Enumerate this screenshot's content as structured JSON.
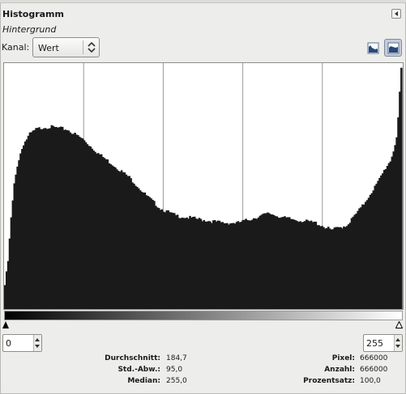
{
  "panel": {
    "title": "Histogramm",
    "layer_name": "Hintergrund"
  },
  "channel": {
    "label": "Kanal:",
    "selected": "Wert"
  },
  "mode_buttons": [
    {
      "name": "linear-histogram",
      "active": false
    },
    {
      "name": "logarithmic-histogram",
      "active": true
    }
  ],
  "range": {
    "low": "0",
    "high": "255"
  },
  "stats": {
    "mean_label": "Durchschnitt:",
    "mean_value": "184,7",
    "std_label": "Std.-Abw.:",
    "std_value": "95,0",
    "median_label": "Median:",
    "median_value": "255,0",
    "pixels_label": "Pixel:",
    "pixels_value": "666000",
    "count_label": "Anzahl:",
    "count_value": "666000",
    "percentile_label": "Prozentsatz:",
    "percentile_value": "100,0"
  },
  "colors": {
    "bars": "#1a1a1a",
    "background": "#ededeb",
    "graph_bg": "#ffffff"
  },
  "chart_data": {
    "type": "area",
    "x_range": [
      0,
      255
    ],
    "y_range": [
      0,
      1
    ],
    "grid": true,
    "title": "",
    "xlabel": "",
    "ylabel": "",
    "x": [
      0,
      2,
      4,
      6,
      8,
      10,
      12,
      16,
      20,
      25,
      30,
      40,
      50,
      60,
      70,
      80,
      90,
      100,
      110,
      120,
      130,
      140,
      150,
      160,
      170,
      180,
      190,
      200,
      210,
      220,
      230,
      235,
      240,
      245,
      248,
      250,
      252,
      253,
      254,
      255
    ],
    "values": [
      0.1,
      0.2,
      0.38,
      0.52,
      0.6,
      0.65,
      0.69,
      0.73,
      0.75,
      0.76,
      0.76,
      0.75,
      0.71,
      0.65,
      0.6,
      0.55,
      0.48,
      0.42,
      0.39,
      0.38,
      0.37,
      0.36,
      0.36,
      0.38,
      0.4,
      0.38,
      0.37,
      0.36,
      0.33,
      0.35,
      0.43,
      0.48,
      0.53,
      0.59,
      0.62,
      0.66,
      0.72,
      0.8,
      0.9,
      1.0
    ]
  }
}
